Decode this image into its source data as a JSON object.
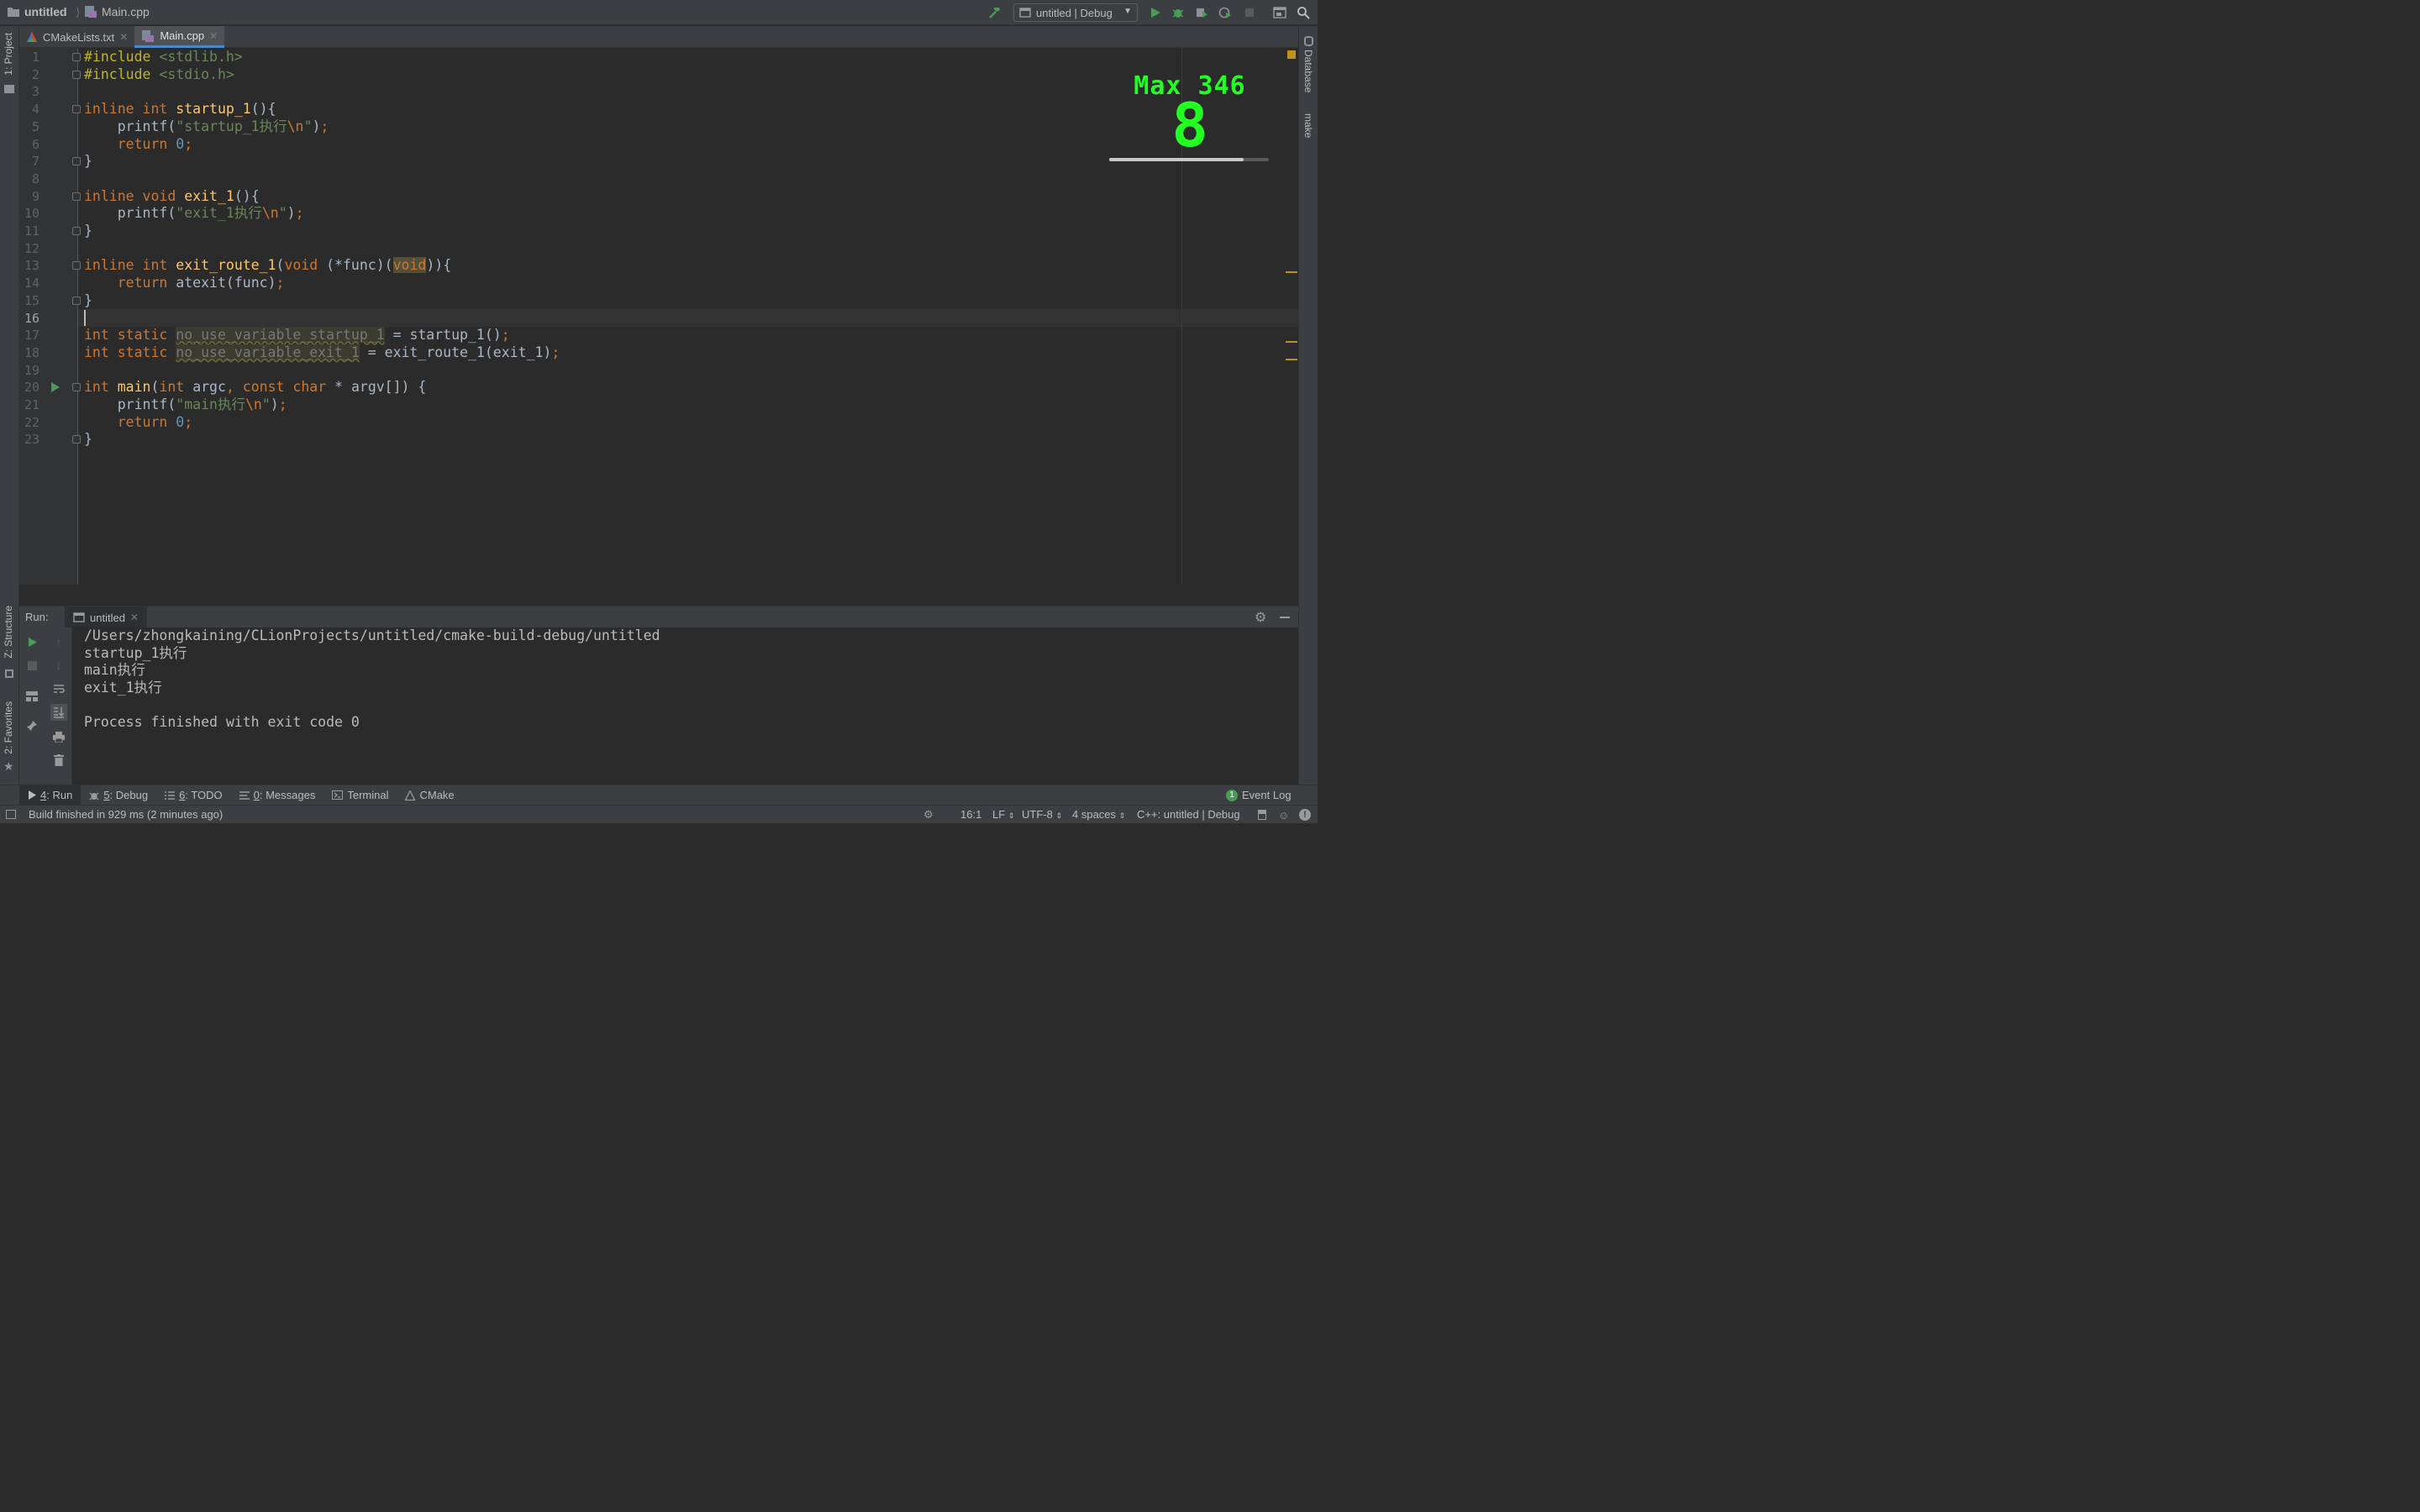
{
  "navbar": {
    "project_name": "untitled",
    "file_name": "Main.cpp",
    "run_config": "untitled | Debug"
  },
  "left_strip": {
    "project_tab": "1: Project",
    "structure_tab": "Z: Structure",
    "favorites_tab": "2: Favorites"
  },
  "right_strip": {
    "database_tab": "Database",
    "make_tab": "make"
  },
  "editor_tabs": [
    {
      "label": "CMakeLists.txt",
      "active": false
    },
    {
      "label": "Main.cpp",
      "active": true
    }
  ],
  "editor": {
    "line_numbers": [
      "1",
      "2",
      "3",
      "4",
      "5",
      "6",
      "7",
      "8",
      "9",
      "10",
      "11",
      "12",
      "13",
      "14",
      "15",
      "16",
      "17",
      "18",
      "19",
      "20",
      "21",
      "22",
      "23"
    ],
    "current_line": 16,
    "lines": [
      [
        [
          "pp",
          "#include "
        ],
        [
          "str",
          "<stdlib.h>"
        ]
      ],
      [
        [
          "pp",
          "#include "
        ],
        [
          "str",
          "<stdio.h>"
        ]
      ],
      [],
      [
        [
          "kw",
          "inline int "
        ],
        [
          "fn",
          "startup_1"
        ],
        [
          "plain",
          "(){"
        ]
      ],
      [
        [
          "plain",
          "    printf("
        ],
        [
          "str",
          "\"startup_1执行"
        ],
        [
          "kw",
          "\\n"
        ],
        [
          "str",
          "\""
        ],
        [
          "plain",
          ")"
        ],
        [
          "kw",
          ";"
        ]
      ],
      [
        [
          "plain",
          "    "
        ],
        [
          "kw",
          "return "
        ],
        [
          "num",
          "0"
        ],
        [
          "kw",
          ";"
        ]
      ],
      [
        [
          "plain",
          "}"
        ]
      ],
      [],
      [
        [
          "kw",
          "inline void "
        ],
        [
          "fn",
          "exit_1"
        ],
        [
          "plain",
          "(){"
        ]
      ],
      [
        [
          "plain",
          "    printf("
        ],
        [
          "str",
          "\"exit_1执行"
        ],
        [
          "kw",
          "\\n"
        ],
        [
          "str",
          "\""
        ],
        [
          "plain",
          ")"
        ],
        [
          "kw",
          ";"
        ]
      ],
      [
        [
          "plain",
          "}"
        ]
      ],
      [],
      [
        [
          "kw",
          "inline int "
        ],
        [
          "fn",
          "exit_route_1"
        ],
        [
          "plain",
          "("
        ],
        [
          "kw",
          "void "
        ],
        [
          "plain",
          "(*func)("
        ],
        [
          "hl-void",
          "void"
        ],
        [
          "plain",
          "))"
        ],
        [
          "plain",
          "{"
        ]
      ],
      [
        [
          "plain",
          "    "
        ],
        [
          "kw",
          "return "
        ],
        [
          "plain",
          "atexit(func)"
        ],
        [
          "kw",
          ";"
        ]
      ],
      [
        [
          "plain",
          "}"
        ]
      ],
      [],
      [
        [
          "kw",
          "int static "
        ],
        [
          "unused",
          "no_use_variable_startup_1"
        ],
        [
          "plain",
          " = startup_1()"
        ],
        [
          "kw",
          ";"
        ]
      ],
      [
        [
          "kw",
          "int static "
        ],
        [
          "unused",
          "no_use_variable_exit_1"
        ],
        [
          "plain",
          " = exit_route_1(exit_1)"
        ],
        [
          "kw",
          ";"
        ]
      ],
      [],
      [
        [
          "kw",
          "int "
        ],
        [
          "fn",
          "main"
        ],
        [
          "plain",
          "("
        ],
        [
          "kw",
          "int "
        ],
        [
          "plain",
          "argc"
        ],
        [
          "kw",
          ", const char "
        ],
        [
          "plain",
          "* argv[]) {"
        ]
      ],
      [
        [
          "plain",
          "    printf("
        ],
        [
          "str",
          "\"main执行"
        ],
        [
          "kw",
          "\\n"
        ],
        [
          "str",
          "\""
        ],
        [
          "plain",
          ")"
        ],
        [
          "kw",
          ";"
        ]
      ],
      [
        [
          "plain",
          "    "
        ],
        [
          "kw",
          "return "
        ],
        [
          "num",
          "0"
        ],
        [
          "kw",
          ";"
        ]
      ],
      [
        [
          "plain",
          "}"
        ]
      ]
    ]
  },
  "power_mode": {
    "max_label": "Max 346",
    "combo": "8",
    "progress_fraction": 0.84
  },
  "run_panel": {
    "label": "Run:",
    "tab_label": "untitled",
    "output": [
      "/Users/zhongkaining/CLionProjects/untitled/cmake-build-debug/untitled",
      "startup_1执行",
      "main执行",
      "exit_1执行",
      "",
      "Process finished with exit code 0"
    ]
  },
  "bottom_tabs": [
    {
      "num": "4",
      "label": ": Run",
      "icon": "play-icon",
      "active": true
    },
    {
      "num": "5",
      "label": ": Debug",
      "icon": "bug-icon",
      "active": false
    },
    {
      "num": "6",
      "label": ": TODO",
      "icon": "list-icon",
      "active": false
    },
    {
      "num": "0",
      "label": ": Messages",
      "icon": "messages-icon",
      "active": false
    },
    {
      "num": "",
      "label": "Terminal",
      "icon": "terminal-icon",
      "active": false
    },
    {
      "num": "",
      "label": "CMake",
      "icon": "cmake-icon",
      "active": false
    }
  ],
  "event_log": {
    "count": "1",
    "label": "Event Log"
  },
  "status_bar": {
    "message": "Build finished in 929 ms (2 minutes ago)",
    "position": "16:1",
    "line_sep": "LF",
    "encoding": "UTF-8",
    "indent": "4 spaces",
    "context": "C++: untitled | Debug"
  },
  "colors": {
    "accent_blue": "#4a88c7",
    "power_green": "#22ff22",
    "run_green": "#499c54",
    "warning_stripe": "#be9117"
  }
}
